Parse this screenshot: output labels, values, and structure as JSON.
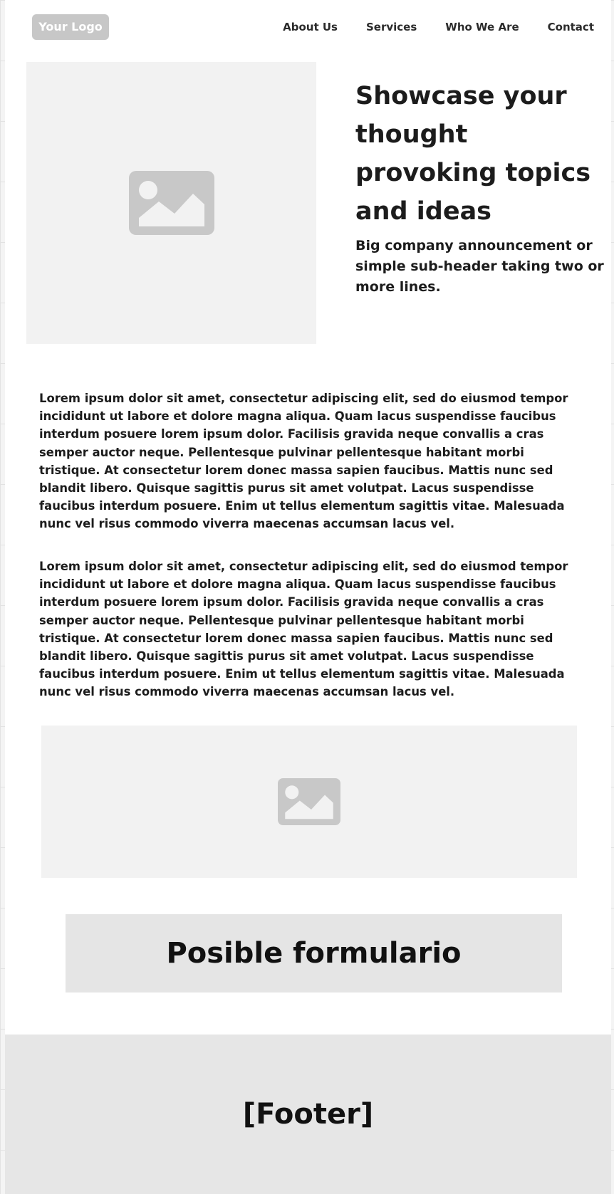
{
  "header": {
    "logo": "Your Logo",
    "nav": [
      "About Us",
      "Services",
      "Who We Are",
      "Contact"
    ]
  },
  "hero": {
    "image_icon": "image-placeholder-icon",
    "headline": "Showcase your thought provoking topics and ideas",
    "subheader": "Big company announcement or simple sub-header taking two or more lines."
  },
  "content": {
    "paragraphs": [
      "Lorem ipsum dolor sit amet, consectetur adipiscing elit, sed do eiusmod tempor incididunt ut labore et dolore magna aliqua. Quam lacus suspendisse faucibus interdum posuere lorem ipsum dolor. Facilisis gravida neque convallis a cras semper auctor neque. Pellentesque pulvinar pellentesque habitant morbi tristique. At consectetur lorem donec massa sapien faucibus. Mattis nunc sed blandit libero. Quisque sagittis purus sit amet volutpat. Lacus suspendisse faucibus interdum posuere. Enim ut tellus elementum sagittis vitae. Malesuada nunc vel risus commodo viverra maecenas accumsan lacus vel.",
      "Lorem ipsum dolor sit amet, consectetur adipiscing elit, sed do eiusmod tempor incididunt ut labore et dolore magna aliqua. Quam lacus suspendisse faucibus interdum posuere lorem ipsum dolor. Facilisis gravida neque convallis a cras semper auctor neque. Pellentesque pulvinar pellentesque habitant morbi tristique. At consectetur lorem donec massa sapien faucibus. Mattis nunc sed blandit libero. Quisque sagittis purus sit amet volutpat. Lacus suspendisse faucibus interdum posuere. Enim ut tellus elementum sagittis vitae. Malesuada nunc vel risus commodo viverra maecenas accumsan lacus vel."
    ],
    "image_icon": "image-placeholder-icon"
  },
  "form": {
    "label": "Posible formulario"
  },
  "footer": {
    "label": "[Footer]"
  },
  "colors": {
    "placeholder_bg": "#f2f2f2",
    "placeholder_icon": "#c8c8c8",
    "block_bg": "#e5e5e5",
    "logo_bg": "#c7c7c7"
  }
}
